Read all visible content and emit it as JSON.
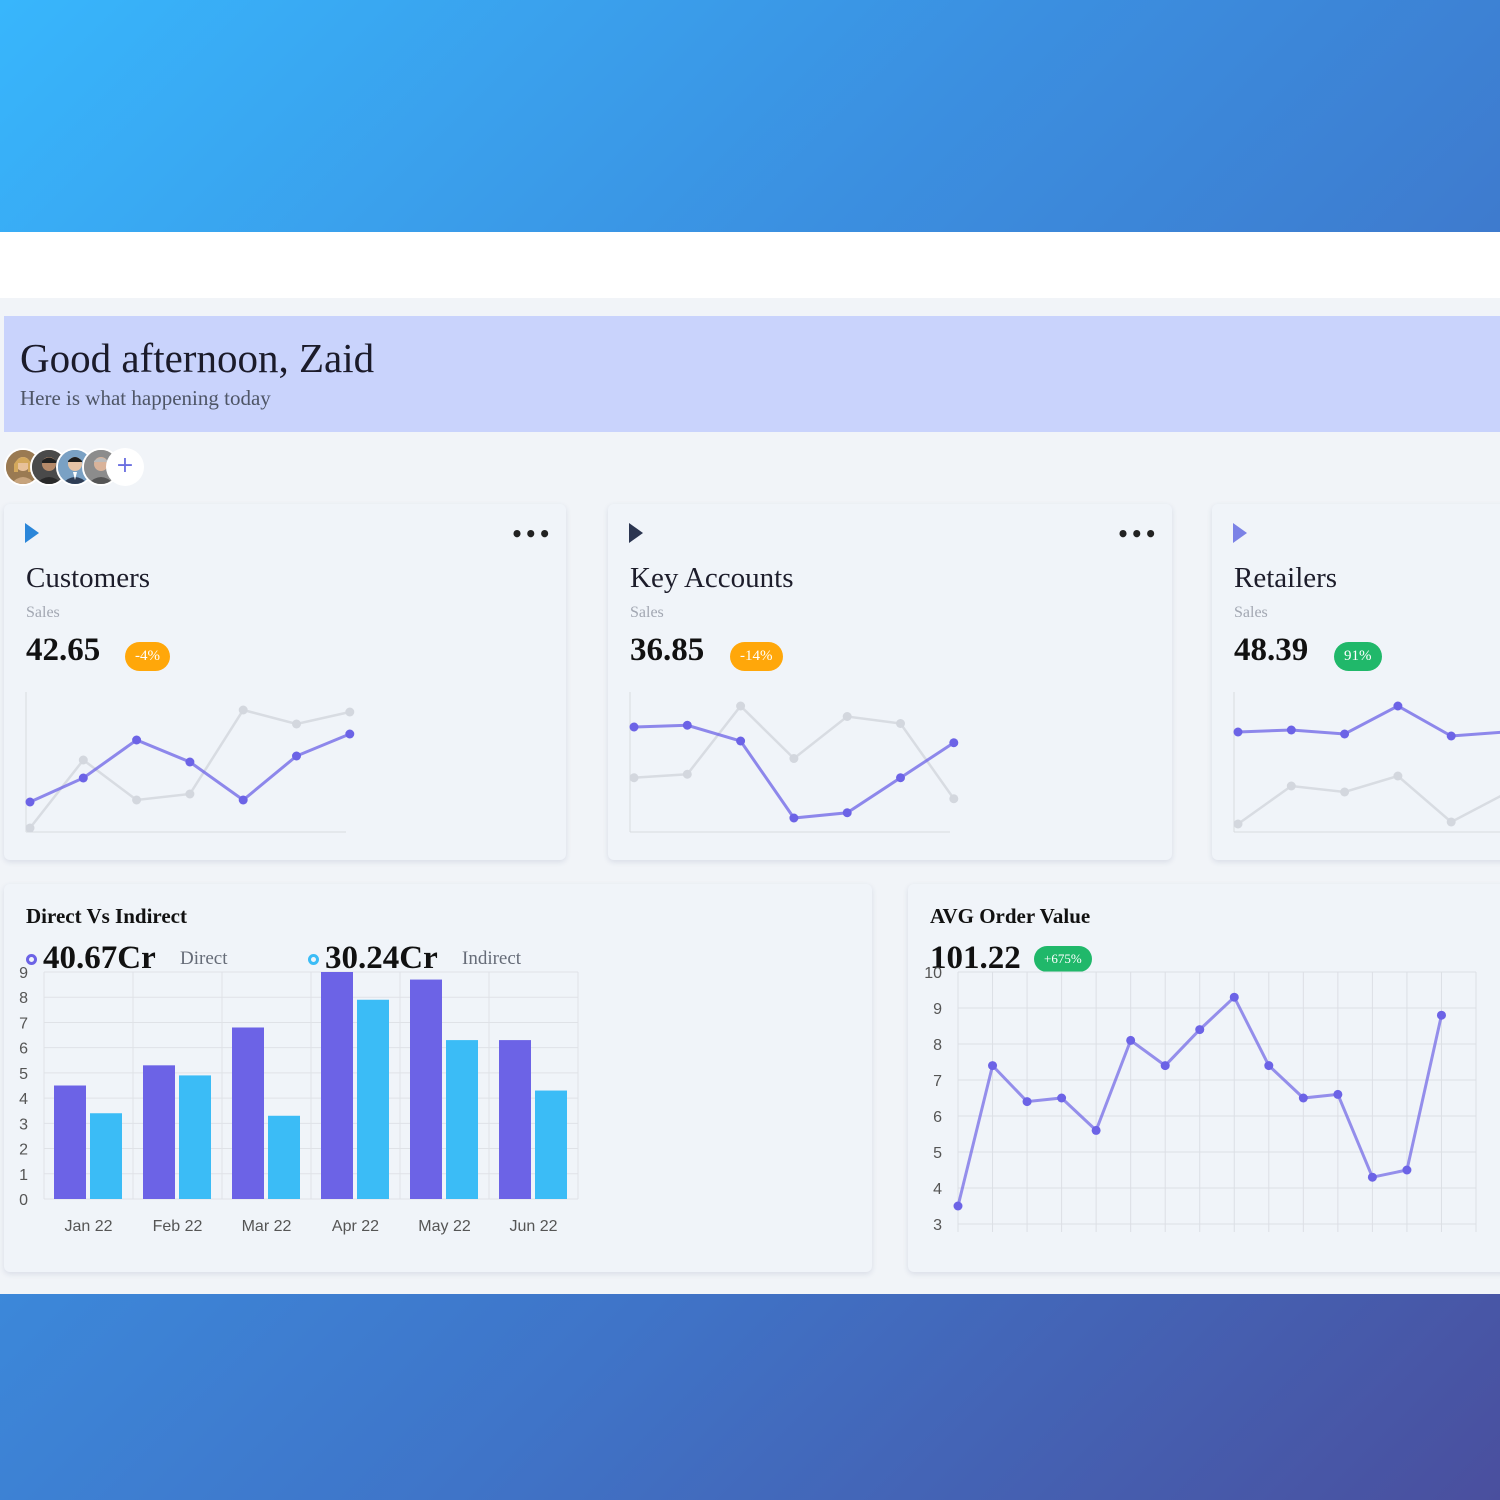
{
  "header": {
    "greeting": "Good afternoon, Zaid",
    "subtitle": "Here is what happening today"
  },
  "team": {
    "avatars": [
      "avatar-1",
      "avatar-2",
      "avatar-3",
      "avatar-4"
    ],
    "add_label": "+"
  },
  "colors": {
    "primary": "#6c63e6",
    "secondary": "#3bbcf6",
    "faded": "#d3d7de",
    "badge_orange": "#ffa70a",
    "badge_green": "#20b86a",
    "flag_blue": "#2b86d9",
    "flag_dark": "#2b3550",
    "flag_violet": "#7b82e6"
  },
  "stat_cards": [
    {
      "title": "Customers",
      "sublabel": "Sales",
      "value": "42.65",
      "change": "-4%",
      "badge_color": "#ffa70a",
      "flag_icon": "play-triangle-icon",
      "chart_data": {
        "type": "line",
        "series": [
          {
            "values": [
              0.2,
              3.6,
              1.6,
              1.9,
              6.1,
              5.4,
              6.0
            ]
          },
          {
            "values": [
              1.5,
              2.7,
              4.6,
              3.5,
              1.6,
              3.8,
              4.9
            ]
          }
        ],
        "ylim": [
          0,
          7
        ]
      }
    },
    {
      "title": "Key Accounts",
      "sublabel": "Sales",
      "value": "36.85",
      "change": "-14%",
      "badge_color": "#ffa70a",
      "flag_icon": "play-triangle-icon",
      "chart_data": {
        "type": "line",
        "series": [
          {
            "values": [
              3.1,
              3.3,
              7.2,
              4.2,
              6.6,
              6.2,
              1.9
            ]
          },
          {
            "values": [
              6.0,
              6.1,
              5.2,
              0.8,
              1.1,
              3.1,
              5.1
            ]
          }
        ],
        "ylim": [
          0,
          8
        ]
      }
    },
    {
      "title": "Retailers",
      "sublabel": "Sales",
      "value": "48.39",
      "change": "91%",
      "badge_color": "#20b86a",
      "flag_icon": "play-triangle-icon",
      "chart_data": {
        "type": "line",
        "series": [
          {
            "values": [
              0.4,
              2.3,
              2.0,
              2.8,
              0.5,
              1.9
            ]
          },
          {
            "values": [
              5.0,
              5.1,
              4.9,
              6.3,
              4.8,
              5.0
            ]
          }
        ],
        "ylim": [
          0,
          7
        ]
      }
    }
  ],
  "direct_vs_indirect": {
    "title": "Direct Vs Indirect",
    "direct_value": "40.67Cr",
    "direct_label": "Direct",
    "indirect_value": "30.24Cr",
    "indirect_label": "Indirect",
    "chart_data": {
      "type": "bar",
      "categories": [
        "Jan 22",
        "Feb 22",
        "Mar 22",
        "Apr 22",
        "May 22",
        "Jun 22"
      ],
      "series": [
        {
          "name": "Direct",
          "values": [
            4.5,
            5.3,
            6.8,
            9.0,
            8.7,
            6.3
          ]
        },
        {
          "name": "Indirect",
          "values": [
            3.4,
            4.9,
            3.3,
            7.9,
            6.3,
            4.3
          ]
        }
      ],
      "ylim": [
        0,
        9
      ],
      "yticks": [
        0,
        1,
        2,
        3,
        4,
        5,
        6,
        7,
        8,
        9
      ],
      "grid": true
    }
  },
  "avg_order_value": {
    "title": "AVG Order Value",
    "value": "101.22",
    "change": "+675%",
    "chart_data": {
      "type": "line",
      "values": [
        3.5,
        7.4,
        6.4,
        6.5,
        5.6,
        8.1,
        7.4,
        8.4,
        9.3,
        7.4,
        6.5,
        6.6,
        4.3,
        4.5,
        8.8
      ],
      "ylim": [
        3,
        10
      ],
      "yticks": [
        3,
        4,
        5,
        6,
        7,
        8,
        9,
        10
      ],
      "grid": true
    }
  }
}
